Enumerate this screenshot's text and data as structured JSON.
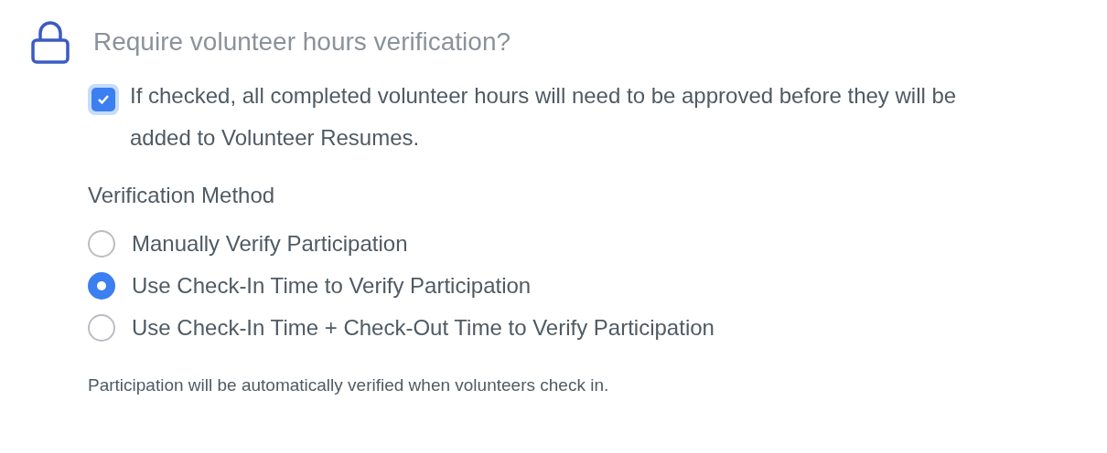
{
  "title": "Require volunteer hours verification?",
  "require_verification": {
    "checked": true,
    "label": "If checked, all completed volunteer hours will need to be approved before they will be added to Volunteer Resumes."
  },
  "verification_method": {
    "label": "Verification Method",
    "options": [
      {
        "label": "Manually Verify Participation",
        "selected": false
      },
      {
        "label": "Use Check-In Time to Verify Participation",
        "selected": true
      },
      {
        "label": "Use Check-In Time + Check-Out Time to Verify Participation",
        "selected": false
      }
    ],
    "help_text": "Participation will be automatically verified when volunteers check in."
  }
}
